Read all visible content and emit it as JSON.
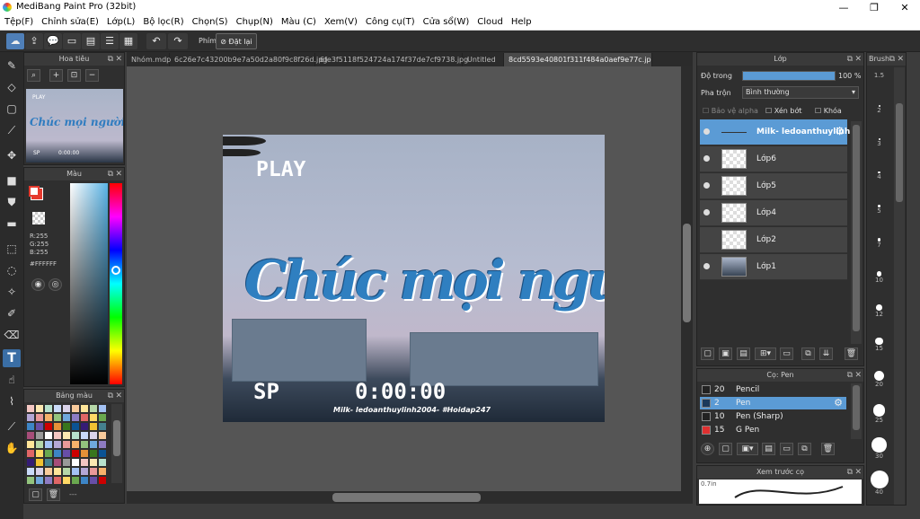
{
  "window": {
    "title": "MediBang Paint Pro (32bit)",
    "min": "—",
    "max": "❐",
    "close": "✕"
  },
  "menu": [
    "Tệp(F)",
    "Chỉnh sửa(E)",
    "Lớp(L)",
    "Bộ lọc(R)",
    "Chọn(S)",
    "Chụp(N)",
    "Màu (C)",
    "Xem(V)",
    "Công cụ(T)",
    "Cửa sổ(W)",
    "Cloud",
    "Help"
  ],
  "toolbar": {
    "shortcut_label": "Phím",
    "reset_label": "Đặt lại"
  },
  "navigator": {
    "title": "Hoa tiêu"
  },
  "color": {
    "title": "Màu",
    "r": "R:255",
    "g": "G:255",
    "b": "B:255",
    "hex": "#FFFFFF"
  },
  "palette": {
    "title": "Bảng màu",
    "dash": "---"
  },
  "tabs": [
    "Nhóm.mdp",
    "6c26e7c43200b9e7a50d2a80f9c8f26d.jpg",
    "6fe3f5118f524724a174f37de7cf9738.jpg",
    "Untitled",
    "8cd5593e40801f311f484a0aef9e77c.jpg"
  ],
  "artwork": {
    "play": "PLAY",
    "sp": "SP",
    "time": "0:00:00",
    "script": "Chúc mọi người",
    "credit": "Milk- ledoanthuylinh2004- #Hoidap247"
  },
  "layers": {
    "title": "Lớp",
    "opacity_label": "Độ trong",
    "opacity_value": "100 %",
    "opacity": 1.0,
    "blend_label": "Pha trộn",
    "blend_value": "Bình thường",
    "protect_alpha": "Bảo vệ alpha",
    "clipping": "Xén bớt",
    "lock": "Khóa",
    "items": [
      {
        "name": "Milk- ledoanthuylinh"
      },
      {
        "name": "Lớp6"
      },
      {
        "name": "Lớp5"
      },
      {
        "name": "Lớp4"
      },
      {
        "name": "Lớp2"
      },
      {
        "name": "Lớp1"
      }
    ]
  },
  "brush_panel": {
    "title": "Cọ: Pen",
    "items": [
      {
        "size": "20",
        "name": "Pencil",
        "color": "#222222"
      },
      {
        "size": "2",
        "name": "Pen",
        "color": "#1b3a5c"
      },
      {
        "size": "10",
        "name": "Pen (Sharp)",
        "color": "#222222"
      },
      {
        "size": "15",
        "name": "G Pen",
        "color": "#e03030"
      }
    ]
  },
  "preview": {
    "title": "Xem trước cọ",
    "size": "0.7in"
  },
  "brush_sizes": {
    "title": "Brush",
    "values": [
      "1.5",
      "2",
      "3",
      "4",
      "5",
      "7",
      "10",
      "12",
      "15",
      "20",
      "25",
      "30",
      "40"
    ]
  }
}
